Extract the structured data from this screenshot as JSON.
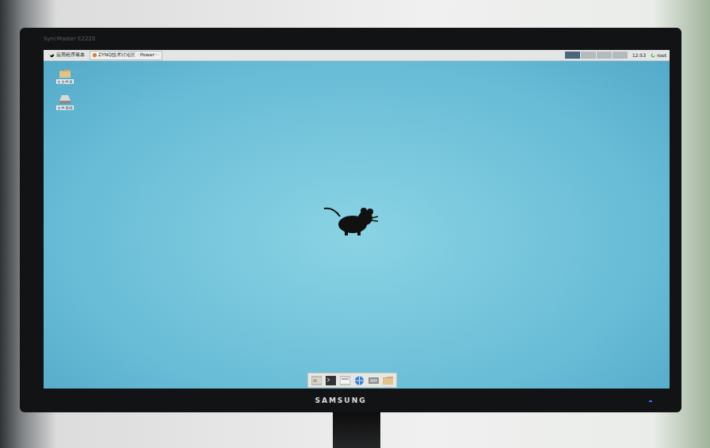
{
  "monitor": {
    "model": "SyncMaster E2220",
    "brand": "SAMSUNG"
  },
  "panel": {
    "menu": "应用程序菜单",
    "tasks": [
      {
        "title": "ZYNQ技术讨论区 · Power···",
        "selected": false
      }
    ],
    "workspaces": [
      {
        "selected": true
      },
      {
        "selected": false
      },
      {
        "selected": false
      },
      {
        "selected": false
      }
    ],
    "clock": "12:53",
    "user": "root"
  },
  "desktop_icons": [
    {
      "label": "主文件夹",
      "kind": "folder"
    },
    {
      "label": "文件系统",
      "kind": "drive"
    }
  ],
  "dock": [
    {
      "kind": "files"
    },
    {
      "kind": "terminal"
    },
    {
      "kind": "manager"
    },
    {
      "kind": "browser"
    },
    {
      "kind": "app"
    },
    {
      "kind": "folder"
    }
  ]
}
